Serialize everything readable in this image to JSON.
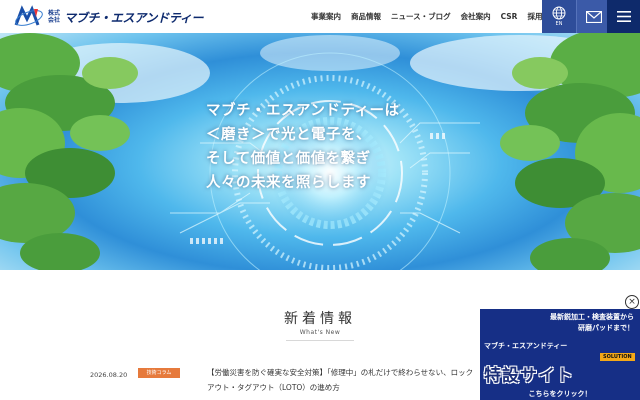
{
  "header": {
    "logo_kabu": "株式会社",
    "logo_name": "マブチ・エスアンドティー",
    "nav": [
      "事業案内",
      "商品情報",
      "ニュース・ブログ",
      "会社案内",
      "CSR",
      "採用情報"
    ],
    "lang_label": "EN",
    "icons": [
      "globe-icon",
      "mail-icon",
      "menu-icon"
    ]
  },
  "hero": {
    "lines": [
      "マブチ・エスアンドティーは",
      "＜磨き＞で光と電子を、",
      "そして価値と価値を繋ぎ",
      "人々の未来を照らします"
    ]
  },
  "news": {
    "title": "新着情報",
    "subtitle": "What's New",
    "items": [
      {
        "date": "2026.08.20",
        "category": "技術コラム",
        "text": "【労働災害を防ぐ確実な安全対策】「修理中」の札だけで終わらせない、ロックアウト・タグアウト（LOTO）の進め方"
      }
    ]
  },
  "banner": {
    "line1": "最新鋭加工・検査装置から",
    "line2": "研磨パッドまで！",
    "company": "マブチ・エスアンドティー",
    "solution": "SOLUTION",
    "big": "特設サイト",
    "cta": "こちらをクリック！",
    "close": "×"
  },
  "colors": {
    "brand_navy": "#0e2a6b",
    "header_blue": "#2e4d9a",
    "category_orange": "#e67a3c",
    "banner_blue": "#162f86"
  }
}
